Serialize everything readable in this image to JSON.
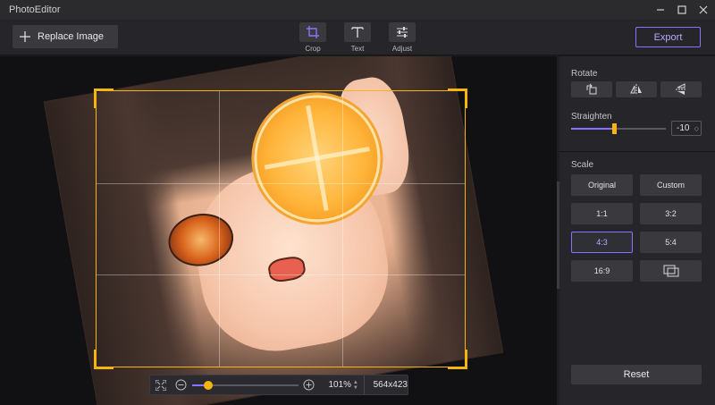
{
  "window": {
    "title": "PhotoEditor",
    "controls": {
      "minimize_icon": "minimize-icon",
      "maximize_icon": "maximize-icon",
      "close_icon": "close-icon"
    }
  },
  "toolbar": {
    "replace_label": "Replace Image",
    "tools": [
      {
        "label": "Crop",
        "icon": "crop-icon",
        "active": true
      },
      {
        "label": "Text",
        "icon": "text-icon",
        "active": false
      },
      {
        "label": "Adjust",
        "icon": "adjust-sliders-icon",
        "active": false
      }
    ],
    "export_label": "Export"
  },
  "zoom": {
    "percent_text": "101%",
    "slider_fraction": 0.15,
    "dimensions": "564x423"
  },
  "panel": {
    "rotate": {
      "title": "Rotate",
      "buttons": [
        "rotate-90-icon",
        "flip-horizontal-icon",
        "flip-vertical-icon"
      ]
    },
    "straighten": {
      "title": "Straighten",
      "value_text": "-10",
      "slider_fraction": 0.45
    },
    "scale": {
      "title": "Scale",
      "options": [
        {
          "label": "Original",
          "selected": false
        },
        {
          "label": "Custom",
          "selected": false
        },
        {
          "label": "1:1",
          "selected": false
        },
        {
          "label": "3:2",
          "selected": false
        },
        {
          "label": "4:3",
          "selected": true
        },
        {
          "label": "5:4",
          "selected": false
        },
        {
          "label": "16:9",
          "selected": false
        },
        {
          "label": "",
          "icon": "screen-ratio-icon",
          "selected": false
        }
      ]
    },
    "reset_label": "Reset"
  },
  "colors": {
    "accent": "#8a72ff",
    "crop_handle": "#f5b50d",
    "panel_bg": "#26262a",
    "canvas_bg": "#111113"
  }
}
